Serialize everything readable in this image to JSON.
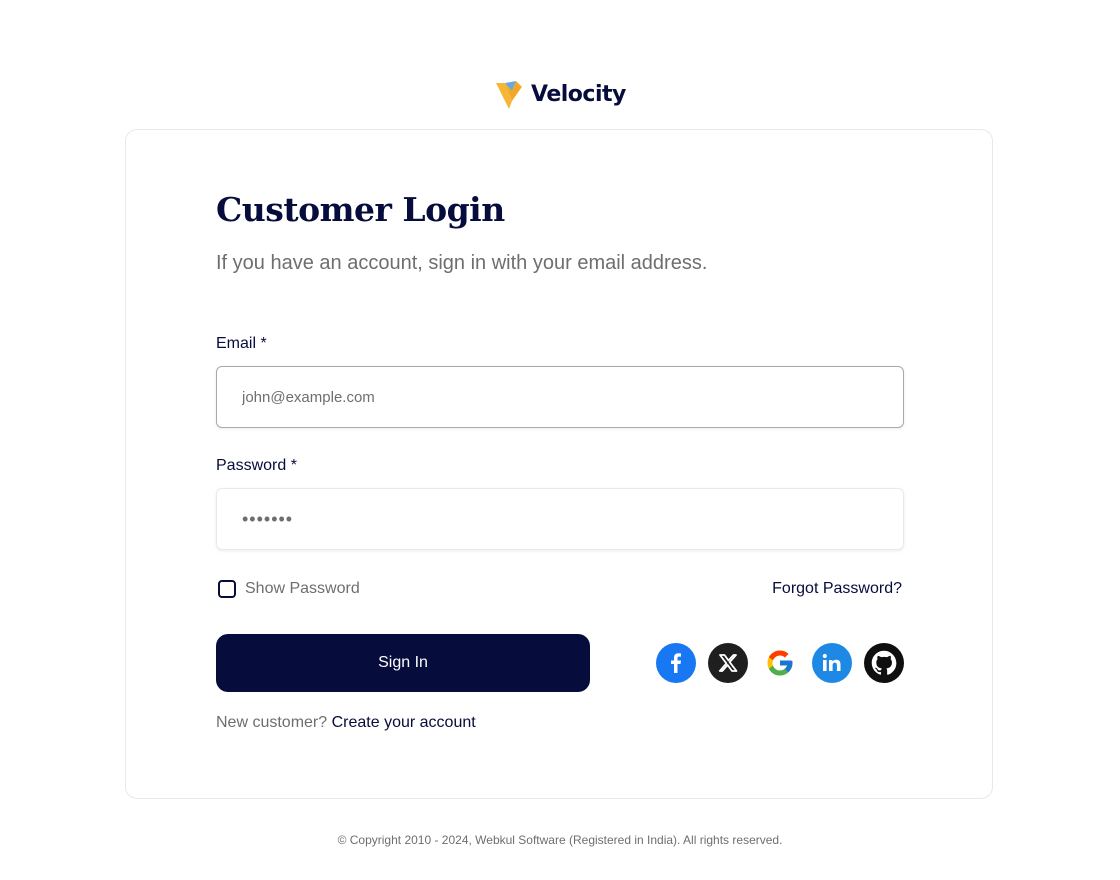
{
  "logo": {
    "text": "Velocity"
  },
  "login": {
    "title": "Customer Login",
    "subtitle": "If you have an account, sign in with your email address.",
    "email": {
      "label": "Email *",
      "placeholder": "john@example.com",
      "value": ""
    },
    "password": {
      "label": "Password *",
      "value": "•••••••"
    },
    "show_password_label": "Show Password",
    "show_password_checked": false,
    "forgot_password_label": "Forgot Password?",
    "sign_in_label": "Sign In",
    "new_customer_text": "New customer?",
    "create_account_label": "Create your account"
  },
  "social": [
    {
      "name": "facebook-icon",
      "color": "#1877f2"
    },
    {
      "name": "x-twitter-icon",
      "color": "#1f1f1f"
    },
    {
      "name": "google-icon",
      "color": "#ffffff"
    },
    {
      "name": "linkedin-icon",
      "color": "#1e88e5"
    },
    {
      "name": "github-icon",
      "color": "#0f0f0f"
    }
  ],
  "footer": {
    "copyright": "© Copyright 2010 - 2024, Webkul Software (Registered in India). All rights reserved."
  },
  "colors": {
    "brand_navy": "#060c3b",
    "text_muted": "#6e6e6e",
    "logo_yellow": "#f5b535"
  }
}
